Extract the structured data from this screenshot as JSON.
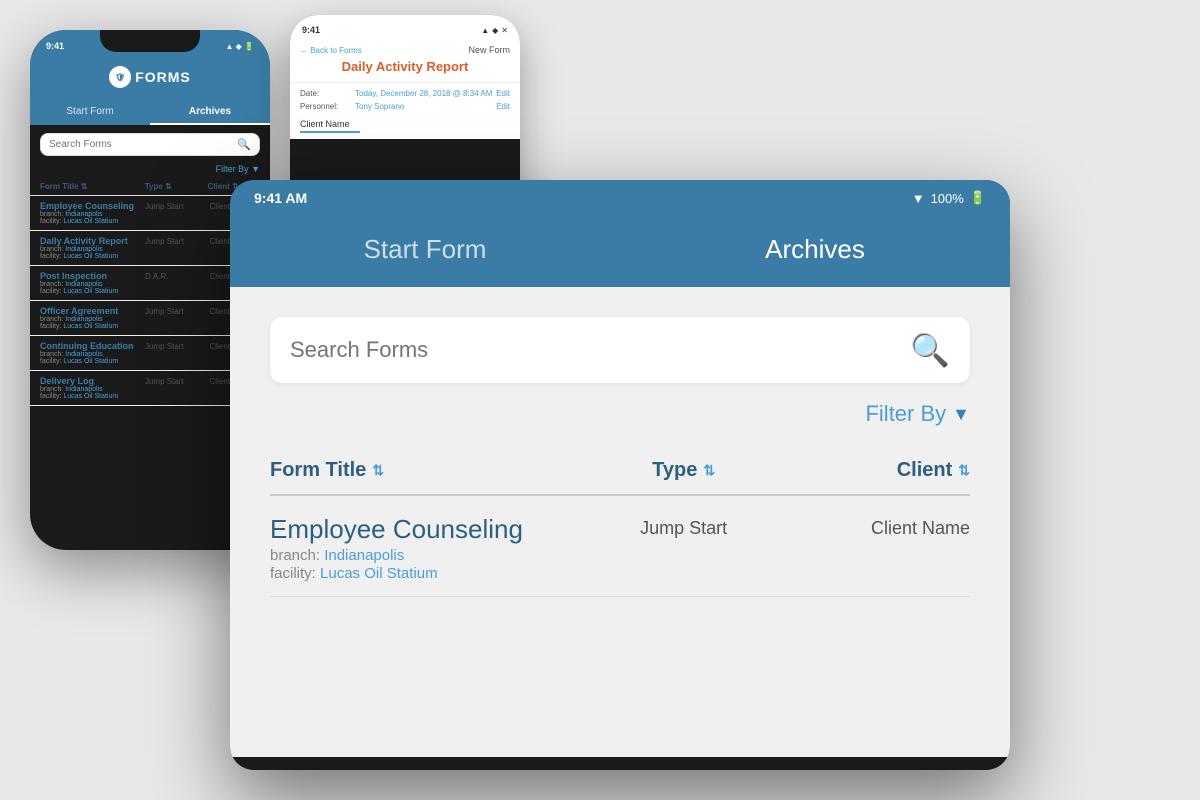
{
  "scene": {
    "background": "#e8e8e8"
  },
  "phone_left": {
    "status_bar": {
      "time": "9:41",
      "icons": "▲ ◆ 🔋"
    },
    "header": {
      "logo_text": "🛡",
      "title": "FORMS"
    },
    "tabs": [
      {
        "label": "Start Form",
        "active": false
      },
      {
        "label": "Archives",
        "active": true
      }
    ],
    "search": {
      "placeholder": "Search Forms"
    },
    "filter_label": "Filter By ▼",
    "columns": [
      {
        "label": "Form Title ⇅"
      },
      {
        "label": "Type ⇅"
      },
      {
        "label": "Client ⇅"
      }
    ],
    "rows": [
      {
        "title": "Employee Counseling",
        "branch": "Indianapolis",
        "facility": "Lucas Oil Statium",
        "type": "Jump Start",
        "client": "Client Nam"
      },
      {
        "title": "Daily Activity Report",
        "branch": "Indianapolis",
        "facility": "Lucas Oil Statium",
        "type": "Jump Start",
        "client": "Client Na"
      },
      {
        "title": "Post Inspection",
        "branch": "Indianapolis",
        "facility": "Lucas Oil Statium",
        "type": "D.A.R.",
        "client": "Client Na"
      },
      {
        "title": "Officer Agreement",
        "branch": "Indianapolis",
        "facility": "Lucas Oil Statium",
        "type": "Jump Start",
        "client": "Client Na"
      },
      {
        "title": "Continuing Education",
        "branch": "Indianapolis",
        "facility": "Lucas Oil Statium",
        "type": "Jump Start",
        "client": "Client Na"
      },
      {
        "title": "Delivery Log",
        "branch": "Indianapolis",
        "facility": "Lucas Oil Statium",
        "type": "Jump Start",
        "client": "Client Na"
      }
    ]
  },
  "phone_right": {
    "status_bar": {
      "time": "9:41",
      "icons": "▲ ◆ ✕"
    },
    "back_link": "← Back to Forms",
    "form_title": "Daily Activity Report",
    "new_form_label": "New Form",
    "fields": [
      {
        "label": "Date:",
        "value": "Today, December 28, 2018 @ 8:34 AM",
        "edit": "Edit"
      },
      {
        "label": "Personnel:",
        "value": "Tony Soprano",
        "edit": "Edit"
      }
    ],
    "client_name_label": "Client Name"
  },
  "ipad": {
    "status_bar": {
      "time": "9:41 AM",
      "wifi": "▼",
      "battery": "100%"
    },
    "tabs": [
      {
        "label": "Start Form",
        "active": false
      },
      {
        "label": "Archives",
        "active": true
      }
    ],
    "search": {
      "placeholder": "Search Forms"
    },
    "filter_label": "Filter By",
    "columns": [
      {
        "label": "Form Title"
      },
      {
        "label": "Type"
      },
      {
        "label": "Client"
      }
    ],
    "rows": [
      {
        "title": "Employee Counseling",
        "branch_label": "branch:",
        "branch": "Indianapolis",
        "facility_label": "facility:",
        "facility": "Lucas Oil Statium",
        "type": "Jump Start",
        "client": "Client Name"
      }
    ]
  }
}
